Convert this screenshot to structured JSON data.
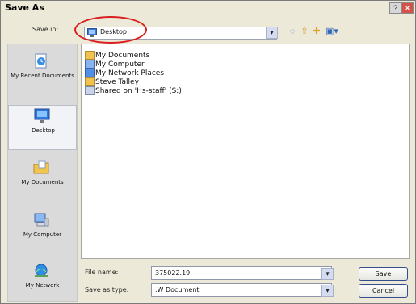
{
  "window": {
    "title": "Save As"
  },
  "toolbar": {
    "save_in_label": "Save in:",
    "save_in_value": "Desktop"
  },
  "places": [
    {
      "label": "My Recent Documents",
      "icon": "recent-documents-icon"
    },
    {
      "label": "Desktop",
      "icon": "desktop-icon",
      "selected": true
    },
    {
      "label": "My Documents",
      "icon": "my-documents-folder-icon"
    },
    {
      "label": "My Computer",
      "icon": "my-computer-icon"
    },
    {
      "label": "My Network",
      "icon": "my-network-icon"
    }
  ],
  "files": [
    {
      "name": "My Documents",
      "icon": "folder-icon"
    },
    {
      "name": "My Computer",
      "icon": "computer-icon"
    },
    {
      "name": "My Network Places",
      "icon": "network-icon"
    },
    {
      "name": "Steve Talley",
      "icon": "folder-icon"
    },
    {
      "name": "Shared on 'Hs-staff' (S:)",
      "icon": "network-drive-icon"
    }
  ],
  "form": {
    "file_name_label": "File name:",
    "file_name_value": "375022.19",
    "save_as_type_label": "Save as type:",
    "save_as_type_value": ".W Document"
  },
  "buttons": {
    "save": "Save",
    "cancel": "Cancel"
  },
  "colors": {
    "accent": "#d91f1f",
    "dialog_bg": "#ece9d8",
    "button_border": "#334d8d"
  }
}
